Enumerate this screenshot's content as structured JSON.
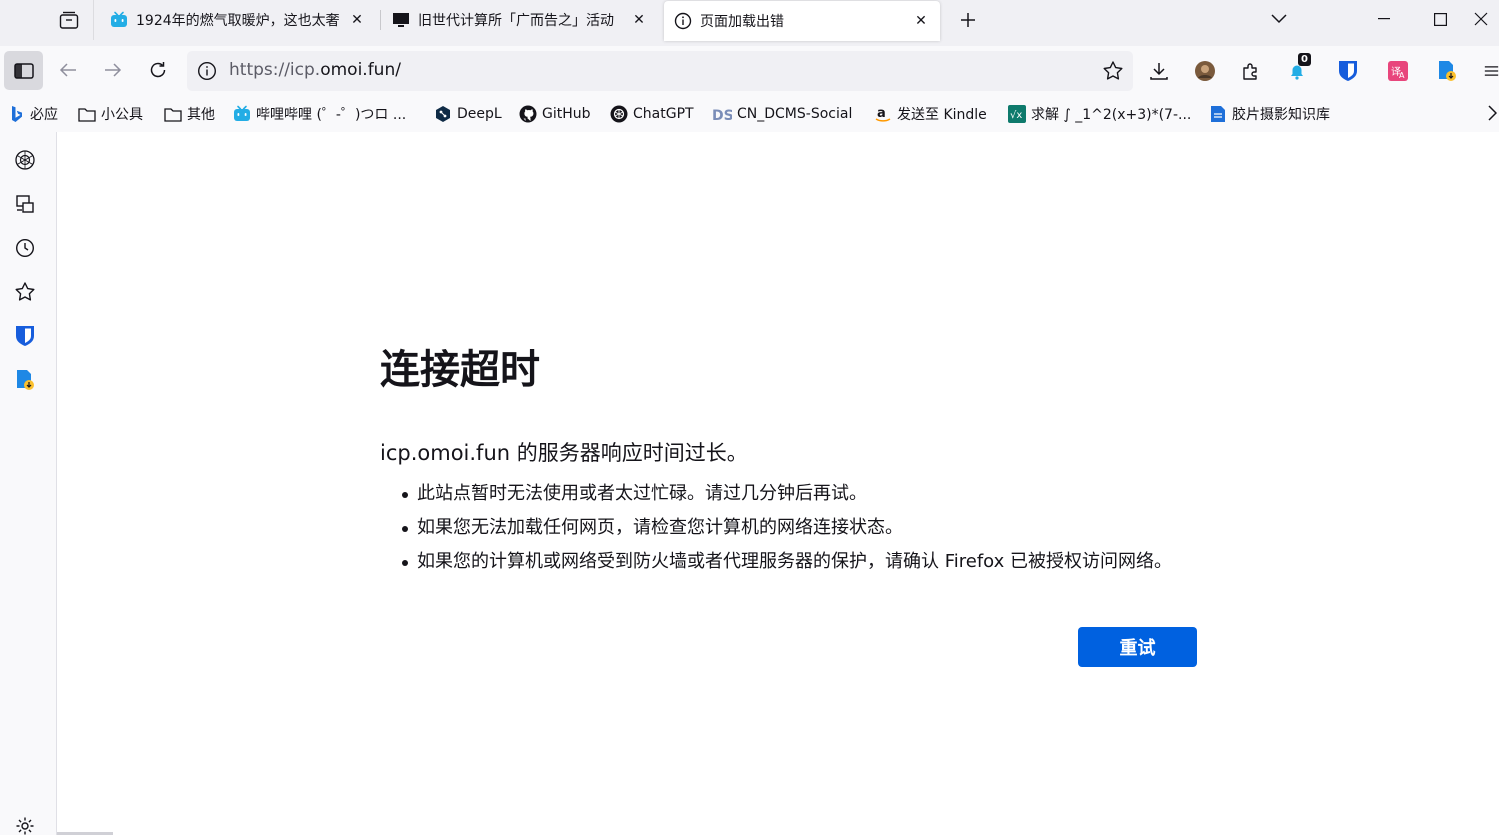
{
  "tabs": [
    {
      "title": "1924年的燃气取暖炉，这也太奢",
      "icon": "bilibili-icon"
    },
    {
      "title": "旧世代计算所「广而告之」活动",
      "icon": "monitor-icon"
    },
    {
      "title": "页面加载出错",
      "icon": "info-icon",
      "active": true
    }
  ],
  "navbar": {
    "url_prefix": "https://icp.",
    "url_host": "omoi.fun/",
    "notification_badge": "0"
  },
  "bookmarks": [
    {
      "label": "必应",
      "icon": "bing-icon"
    },
    {
      "label": "小公具",
      "icon": "folder-icon"
    },
    {
      "label": "其他",
      "icon": "folder-icon"
    },
    {
      "label": "哔哩哔哩 (゜-゜)つロ ...",
      "icon": "bilibili-icon"
    },
    {
      "label": "DeepL",
      "icon": "deepl-icon"
    },
    {
      "label": "GitHub",
      "icon": "github-icon"
    },
    {
      "label": "ChatGPT",
      "icon": "chatgpt-icon"
    },
    {
      "label": "CN_DCMS-Social",
      "icon": "ds-icon"
    },
    {
      "label": "发送至 Kindle",
      "icon": "amazon-icon"
    },
    {
      "label": "求解 ∫ _1^2(x+3)*(7-...",
      "icon": "vx-icon"
    },
    {
      "label": "胶片摄影知识库",
      "icon": "doc-icon"
    }
  ],
  "error": {
    "title": "连接超时",
    "lead": "icp.omoi.fun 的服务器响应时间过长。",
    "items": [
      "此站点暂时无法使用或者太过忙碌。请过几分钟后再试。",
      "如果您无法加载任何网页，请检查您计算机的网络连接状态。",
      "如果您的计算机或网络受到防火墙或者代理服务器的保护，请确认 Firefox 已被授权访问网络。"
    ],
    "retry_label": "重试"
  },
  "colors": {
    "accent": "#0061e0",
    "bilibili": "#23ade5",
    "bitwarden": "#175ddc"
  }
}
